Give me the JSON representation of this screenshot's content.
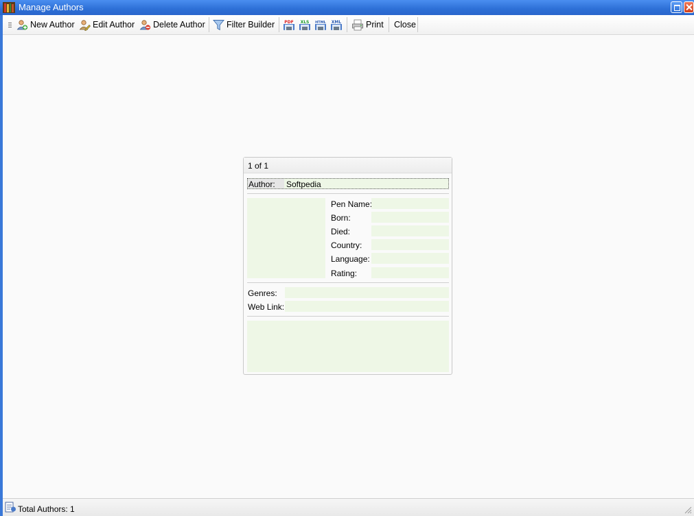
{
  "window": {
    "title": "Manage Authors"
  },
  "toolbar": {
    "new_author": "New Author",
    "edit_author": "Edit Author",
    "delete_author": "Delete Author",
    "filter_builder": "Filter Builder",
    "export_pdf": "PDF",
    "export_xls": "XLS",
    "export_html": "HTML",
    "export_xml": "XML",
    "print": "Print",
    "close": "Close"
  },
  "card": {
    "record_position": "1 of 1",
    "author_label": "Author:",
    "author_value": "Softpedia",
    "fields": {
      "pen_name": {
        "label": "Pen Name:",
        "value": ""
      },
      "born": {
        "label": "Born:",
        "value": ""
      },
      "died": {
        "label": "Died:",
        "value": ""
      },
      "country": {
        "label": "Country:",
        "value": ""
      },
      "language": {
        "label": "Language:",
        "value": ""
      },
      "rating": {
        "label": "Rating:",
        "value": ""
      },
      "genres": {
        "label": "Genres:",
        "value": ""
      },
      "web_link": {
        "label": "Web Link:",
        "value": ""
      }
    }
  },
  "status": {
    "total_authors": "Total Authors: 1"
  },
  "colors": {
    "titlebar": "#2d6fd6",
    "field_background": "#eef7e6",
    "client_background": "#fafafa"
  }
}
